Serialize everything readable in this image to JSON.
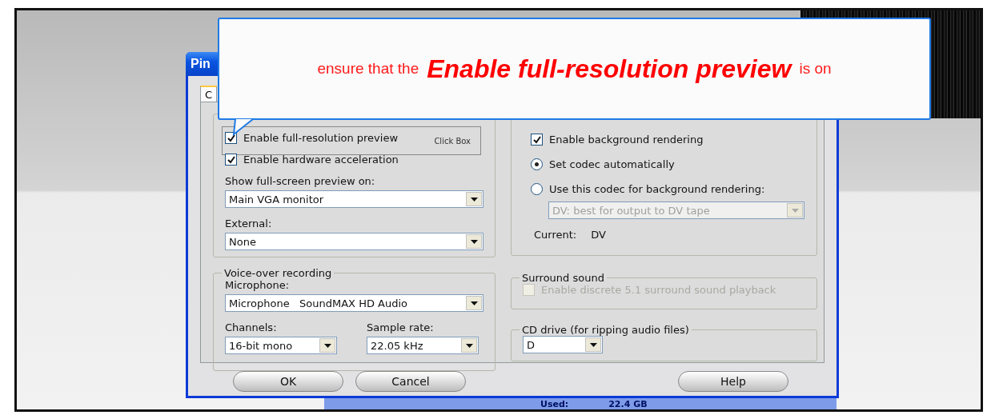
{
  "callout": {
    "lead": "ensure that the",
    "emphasis": "Enable full-resolution preview",
    "tail": "is on"
  },
  "dialog": {
    "title": "Pin",
    "tabs": [
      {
        "label": "C",
        "selected": true
      }
    ],
    "click_box_label": "Click Box",
    "preview": {
      "checkboxes": [
        {
          "label": "Enable full-resolution preview",
          "checked": true,
          "highlighted": true
        },
        {
          "label": "Enable hardware acceleration",
          "checked": true,
          "highlighted": false
        }
      ],
      "fullscreen_label": "Show full-screen preview on:",
      "fullscreen_value": "Main VGA monitor",
      "external_label": "External:",
      "external_value": "None"
    },
    "background": {
      "checkboxes": [
        {
          "label": "Enable background rendering",
          "checked": true
        }
      ],
      "radios": [
        {
          "label": "Set codec automatically",
          "selected": true
        },
        {
          "label": "Use this codec for background rendering:",
          "selected": false
        }
      ],
      "codec_value": "DV: best for output to DV tape",
      "codec_disabled": true,
      "current_label": "Current:",
      "current_value": "DV"
    },
    "voice_over": {
      "title": "Voice-over recording",
      "microphone_label": "Microphone:",
      "microphone_value": "Microphone   SoundMAX HD Audio",
      "channels_label": "Channels:",
      "channels_value": "16-bit mono",
      "rate_label": "Sample rate:",
      "rate_value": "22.05 kHz"
    },
    "surround": {
      "title": "Surround sound",
      "label": "Enable discrete 5.1 surround sound playback",
      "checked": false,
      "disabled": true
    },
    "cd_drive": {
      "title": "CD drive (for ripping audio files)",
      "value": "D"
    },
    "buttons_left": [
      "OK",
      "Cancel"
    ],
    "buttons_right": [
      "Help"
    ]
  },
  "status": {
    "used_label": "Used:",
    "used_value": "22.4 GB"
  }
}
